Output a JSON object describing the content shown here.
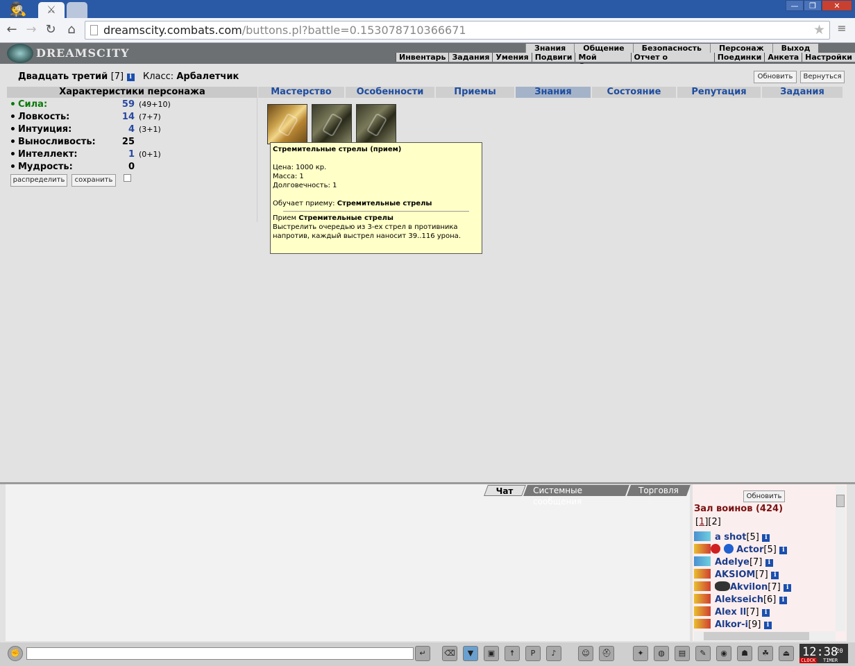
{
  "browser": {
    "url_host": "dreamscity.combats.com",
    "url_path": "/buttons.pl?battle=0.153078710366671"
  },
  "game": {
    "logo": "DREAMSCITY",
    "top_nav": [
      "Знания",
      "Общение",
      "Безопасность",
      "Персонаж",
      "Выход"
    ],
    "sub_nav": [
      "Инвентарь",
      "Задания",
      "Умения",
      "Подвиги",
      "Мой Скролл",
      "Отчет о переводах",
      "Поединки",
      "Анкета",
      "Настройки"
    ]
  },
  "character": {
    "name": "Двадцать третий",
    "level": "[7]",
    "class_label": "Класс:",
    "class_value": "Арбалетчик",
    "refresh_label": "Обновить",
    "back_label": "Вернуться"
  },
  "stats": {
    "title": "Характеристики персонажа",
    "items": [
      {
        "name": "Сила:",
        "value": "59",
        "bonus": "(49+10)"
      },
      {
        "name": "Ловкость:",
        "value": "14",
        "bonus": "(7+7)"
      },
      {
        "name": "Интуиция:",
        "value": "4",
        "bonus": "(3+1)"
      },
      {
        "name": "Выносливость:",
        "value": "25",
        "bonus": ""
      },
      {
        "name": "Интеллект:",
        "value": "1",
        "bonus": "(0+1)"
      },
      {
        "name": "Мудрость:",
        "value": "0",
        "bonus": ""
      }
    ],
    "distribute_label": "распределить",
    "save_label": "сохранить"
  },
  "tabs": [
    "Мастерство",
    "Особенности",
    "Приемы",
    "Знания",
    "Состояние",
    "Репутация",
    "Задания"
  ],
  "selected_tab": "Знания",
  "tooltip": {
    "title": "Стремительные стрелы (прием)",
    "price": "Цена: 1000 кр.",
    "weight": "Масса: 1",
    "durability": "Долговечность: 1",
    "teaches_prefix": "Обучает приему: ",
    "teaches_name": "Стремительные стрелы",
    "skill_prefix": "Прием ",
    "skill_name": "Стремительные стрелы",
    "description": "Выстрелить очередью из 3-ех стрел в противника напротив, каждый выстрел наносит 39..116 урона."
  },
  "chat": {
    "tabs": [
      "Чат",
      "Системные сообщения",
      "Торговля"
    ]
  },
  "online": {
    "refresh_label": "Обновить",
    "hall_title": "Зал воинов (424)",
    "page_current": "1",
    "page_other": "2",
    "players": [
      {
        "name": "a shot",
        "level": "[5]",
        "icon": "cross"
      },
      {
        "name": "Actor",
        "level": "[5]",
        "icon": "arrow"
      },
      {
        "name": "Adelye",
        "level": "[7]",
        "icon": "cross"
      },
      {
        "name": "AKSIOM",
        "level": "[7]",
        "icon": "arrow"
      },
      {
        "name": "Akvilon",
        "level": "[7]",
        "icon": "arrow"
      },
      {
        "name": "Alekseich",
        "level": "[6]",
        "icon": "arrow"
      },
      {
        "name": "Alex ll",
        "level": "[7]",
        "icon": "arrow"
      },
      {
        "name": "Alkor-i",
        "level": "[9]",
        "icon": "arrow"
      }
    ]
  },
  "clock": {
    "time": "12:38",
    "seconds": "20",
    "clock_label": "CLOCK",
    "timer_label": "TIMER"
  }
}
